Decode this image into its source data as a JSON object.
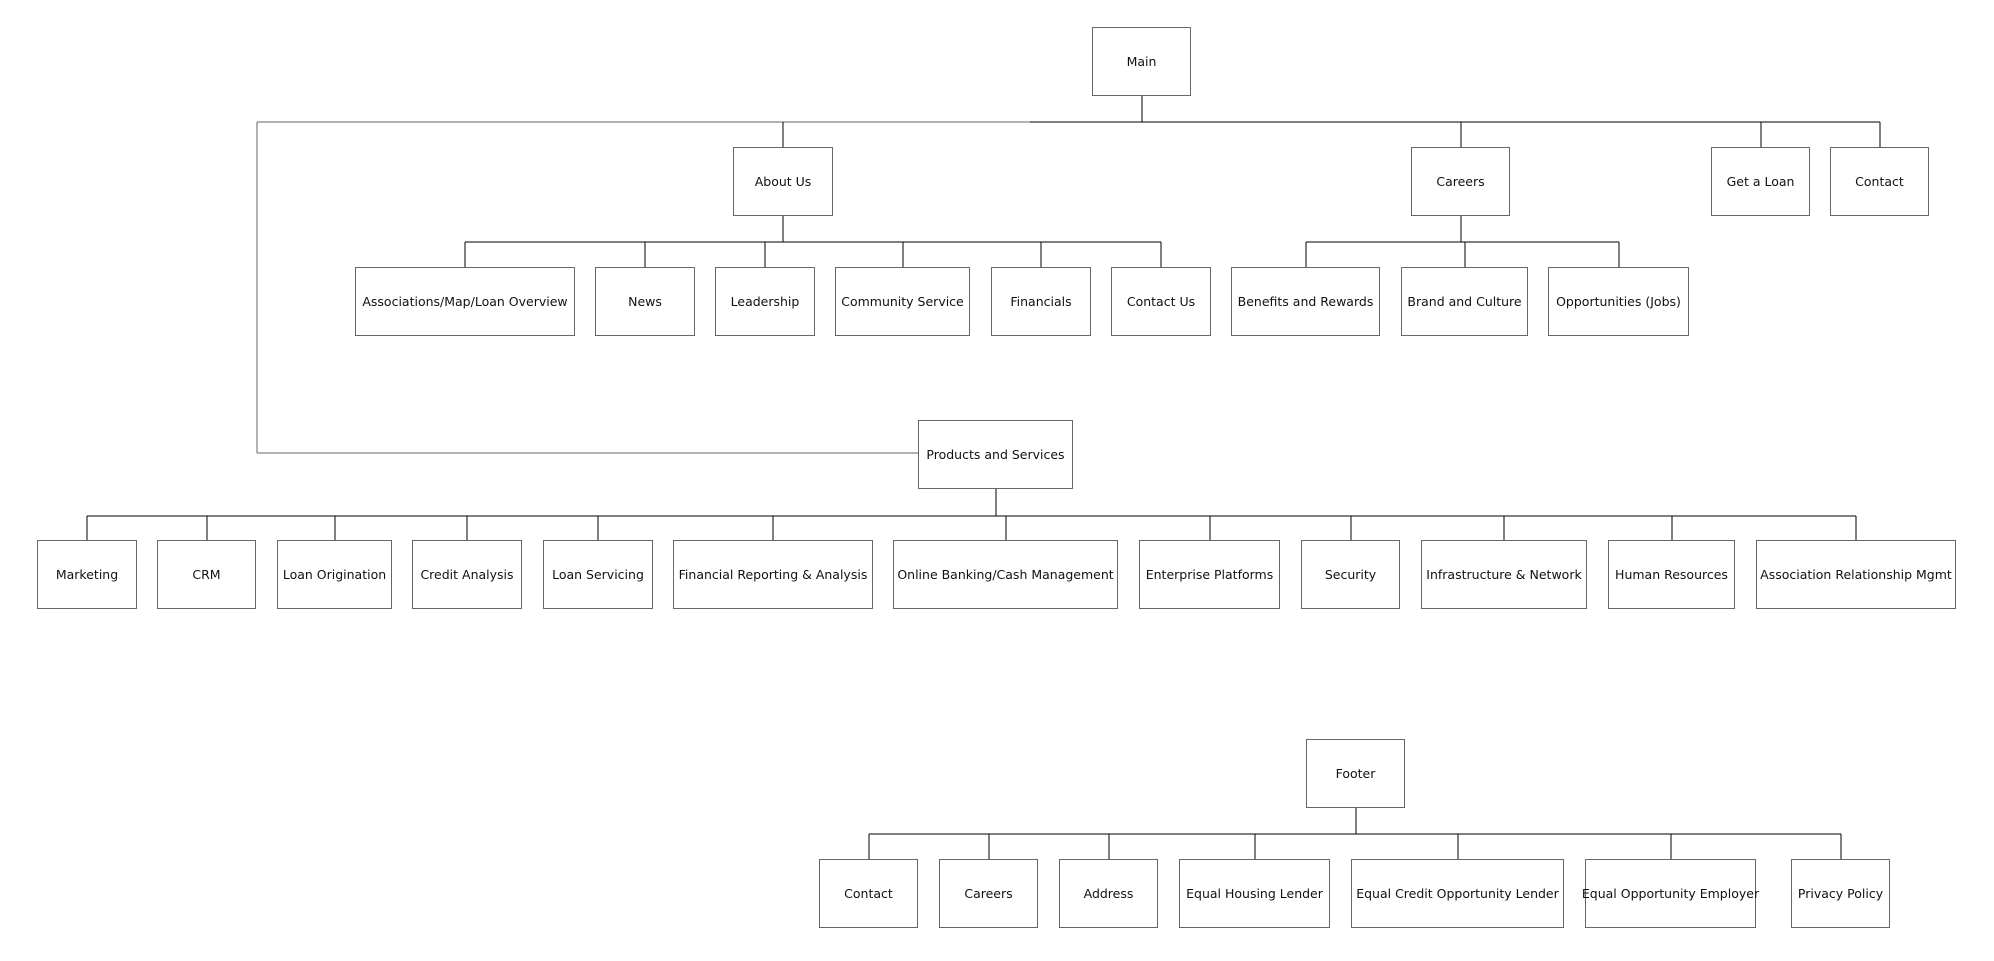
{
  "diagram": {
    "type": "sitemap",
    "colors": {
      "line": "#000000",
      "bracket_line": "#666666",
      "box_border": "#666666",
      "text": "#111111",
      "background": "#ffffff"
    },
    "trees": [
      {
        "id": "main",
        "label": "Main",
        "children": [
          {
            "id": "about",
            "label": "About Us",
            "children": [
              {
                "label": "Associations/Map/Loan Overview"
              },
              {
                "label": "News"
              },
              {
                "label": "Leadership"
              },
              {
                "label": "Community Service"
              },
              {
                "label": "Financials"
              },
              {
                "label": "Contact Us"
              }
            ]
          },
          {
            "id": "careers",
            "label": "Careers",
            "children": [
              {
                "label": "Benefits and Rewards"
              },
              {
                "label": "Brand and Culture"
              },
              {
                "label": "Opportunities (Jobs)"
              }
            ]
          },
          {
            "id": "loan",
            "label": "Get a Loan",
            "children": []
          },
          {
            "id": "contact",
            "label": "Contact",
            "children": []
          },
          {
            "id": "products",
            "label": "Products and Services",
            "children": [
              {
                "label": "Marketing"
              },
              {
                "label": "CRM"
              },
              {
                "label": "Loan Origination"
              },
              {
                "label": "Credit Analysis"
              },
              {
                "label": "Loan Servicing"
              },
              {
                "label": "Financial Reporting & Analysis"
              },
              {
                "label": "Online Banking/Cash Management"
              },
              {
                "label": "Enterprise Platforms"
              },
              {
                "label": "Security"
              },
              {
                "label": "Infrastructure & Network"
              },
              {
                "label": "Human Resources"
              },
              {
                "label": "Association Relationship Mgmt"
              }
            ]
          }
        ]
      },
      {
        "id": "footer",
        "label": "Footer",
        "children": [
          {
            "label": "Contact"
          },
          {
            "label": "Careers"
          },
          {
            "label": "Address"
          },
          {
            "label": "Equal Housing Lender"
          },
          {
            "label": "Equal Credit Opportunity Lender"
          },
          {
            "label": "Equal Opportunity Employer"
          },
          {
            "label": "Privacy Policy"
          }
        ]
      }
    ]
  }
}
